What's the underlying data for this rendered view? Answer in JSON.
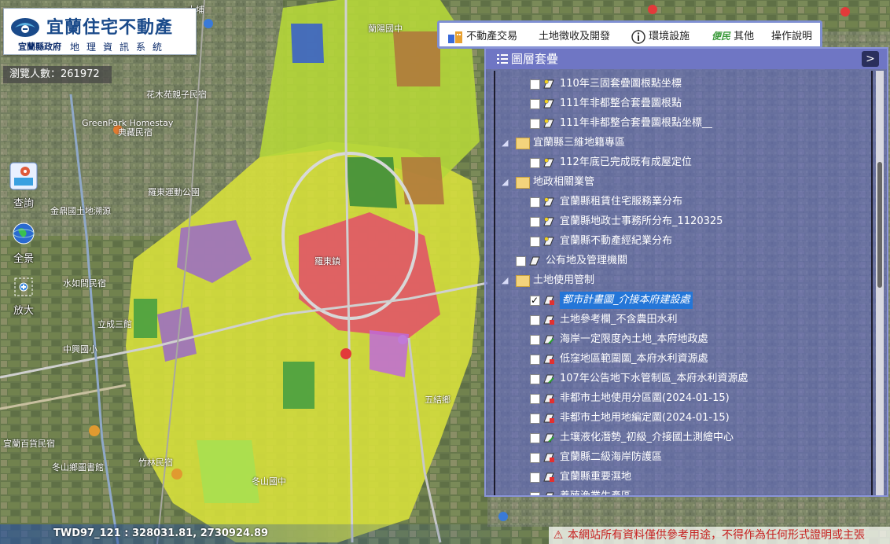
{
  "logo": {
    "title": "宜蘭住宅不動產",
    "gov": "宜蘭縣政府",
    "subtitle": "地理資訊系統"
  },
  "visitors": {
    "text": "瀏覽人數：261972"
  },
  "side_tools": [
    {
      "name": "query-tool",
      "label": "查詢",
      "icon": "query-icon"
    },
    {
      "name": "fullview-tool",
      "label": "全景",
      "icon": "globe-icon"
    },
    {
      "name": "zoomin-tool",
      "label": "放大",
      "icon": "zoom-box-icon"
    }
  ],
  "top_menu": {
    "items": [
      {
        "label": "不動產交易",
        "icon": "real-estate-icon"
      },
      {
        "label": "土地徵收及開發",
        "icon": ""
      },
      {
        "label": "環境設施",
        "icon": "info-icon"
      },
      {
        "label": "其他",
        "icon": "convenience-icon",
        "badge": "便民"
      },
      {
        "label": "操作說明",
        "icon": ""
      }
    ]
  },
  "panel": {
    "title": "圖層套疊",
    "collapse_icon": "chevron-right-icon",
    "rows": [
      {
        "kind": "layer",
        "label": "110年三固套疊圖根點坐標",
        "checked": false,
        "icon": "point-layer-icon"
      },
      {
        "kind": "layer",
        "label": "111年非都整合套疊圖根點",
        "checked": false,
        "icon": "point-layer-icon"
      },
      {
        "kind": "layer",
        "label": "111年非都整合套疊圖根點坐標__",
        "checked": false,
        "icon": "point-layer-icon"
      },
      {
        "kind": "group",
        "label": "宜蘭縣三維地籍專區",
        "expanded": true
      },
      {
        "kind": "layer",
        "label": "112年底已完成既有成屋定位",
        "checked": false,
        "icon": "point-layer-icon"
      },
      {
        "kind": "group",
        "label": "地政相關業管",
        "expanded": true
      },
      {
        "kind": "layer",
        "label": "宜蘭縣租賃住宅服務業分布",
        "checked": false,
        "icon": "point-layer-icon"
      },
      {
        "kind": "layer",
        "label": "宜蘭縣地政士事務所分布_1120325",
        "checked": false,
        "icon": "point-layer-icon"
      },
      {
        "kind": "layer",
        "label": "宜蘭縣不動產經紀業分布",
        "checked": false,
        "icon": "point-layer-icon"
      },
      {
        "kind": "subgroup",
        "label": "公有地及管理機關",
        "checked": false
      },
      {
        "kind": "group",
        "label": "土地使用管制",
        "expanded": true
      },
      {
        "kind": "layer",
        "label": "都市計畫圖_介接本府建設處",
        "checked": true,
        "selected": true,
        "icon": "polygon-layer-icon"
      },
      {
        "kind": "layer",
        "label": "土地參考欄_不含農田水利",
        "checked": false,
        "icon": "polygon-layer-icon"
      },
      {
        "kind": "layer",
        "label": "海岸一定限度內土地_本府地政處",
        "checked": false,
        "icon": "line-layer-icon"
      },
      {
        "kind": "layer",
        "label": "低窪地區範圍圖_本府水利資源處",
        "checked": false,
        "icon": "polygon-layer-icon"
      },
      {
        "kind": "layer",
        "label": "107年公告地下水管制區_本府水利資源處",
        "checked": false,
        "icon": "line-layer-icon"
      },
      {
        "kind": "layer",
        "label": "非都市土地使用分區圖(2024-01-15)",
        "checked": false,
        "icon": "polygon-layer-icon"
      },
      {
        "kind": "layer",
        "label": "非都市土地用地編定圖(2024-01-15)",
        "checked": false,
        "icon": "polygon-layer-icon"
      },
      {
        "kind": "layer",
        "label": "土壤液化潛勢_初級_介接國土測繪中心",
        "checked": false,
        "icon": "line-layer-icon"
      },
      {
        "kind": "layer",
        "label": "宜蘭縣二級海岸防護區",
        "checked": false,
        "icon": "polygon-layer-icon"
      },
      {
        "kind": "layer",
        "label": "宜蘭縣重要濕地",
        "checked": false,
        "icon": "polygon-layer-icon"
      },
      {
        "kind": "layer",
        "label": "養殖漁業生產區",
        "checked": false,
        "icon": "polygon-layer-icon"
      }
    ]
  },
  "coords": {
    "text": "TWD97_121 : 328031.81, 2730924.89"
  },
  "disclaimer": {
    "text": "本網站所有資料僅供參考用途，不得作為任何形式證明或主張"
  },
  "map_labels": [
    "大埔",
    "蘭陽國中",
    "花木苑親子民宿",
    "GreenPark Homestay",
    "羅東運動公園",
    "典藏民宿",
    "金鼎國土地溯源",
    "立成三館",
    "水如間民宿",
    "中興國小",
    "宜蘭百貨民宿",
    "冬山鄉圖書館",
    "羅東鎮",
    "竹林民宿",
    "冬山國中",
    "五結鄉"
  ]
}
